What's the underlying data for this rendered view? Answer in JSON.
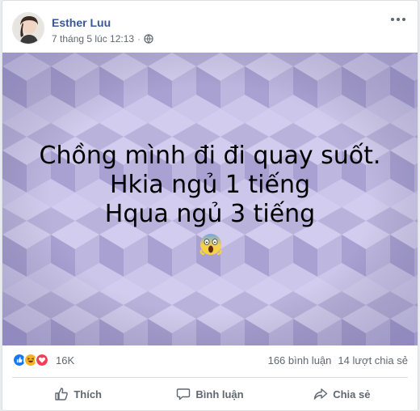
{
  "post": {
    "author": "Esther Luu",
    "timestamp": "7 tháng 5 lúc 12:13",
    "separator": "·",
    "privacy_icon": "globe-icon",
    "text_lines": [
      "Chồng mình đi đi quay suốt.",
      "Hkia ngủ 1 tiếng",
      "Hqua ngủ 3 tiếng"
    ],
    "emoji": "face-screaming-in-fear",
    "background_color": "#b9b3dc"
  },
  "reactions": {
    "icons": [
      "like-reaction-icon",
      "haha-reaction-icon",
      "love-reaction-icon"
    ],
    "count": "16K",
    "comments": "166 bình luận",
    "shares": "14 lượt chia sẻ"
  },
  "actions": {
    "like": "Thích",
    "comment": "Bình luận",
    "share": "Chia sẻ"
  },
  "colors": {
    "author": "#365899",
    "like_blue": "#1877f2",
    "love_red": "#f33e58",
    "haha_yellow": "#f7b125"
  }
}
